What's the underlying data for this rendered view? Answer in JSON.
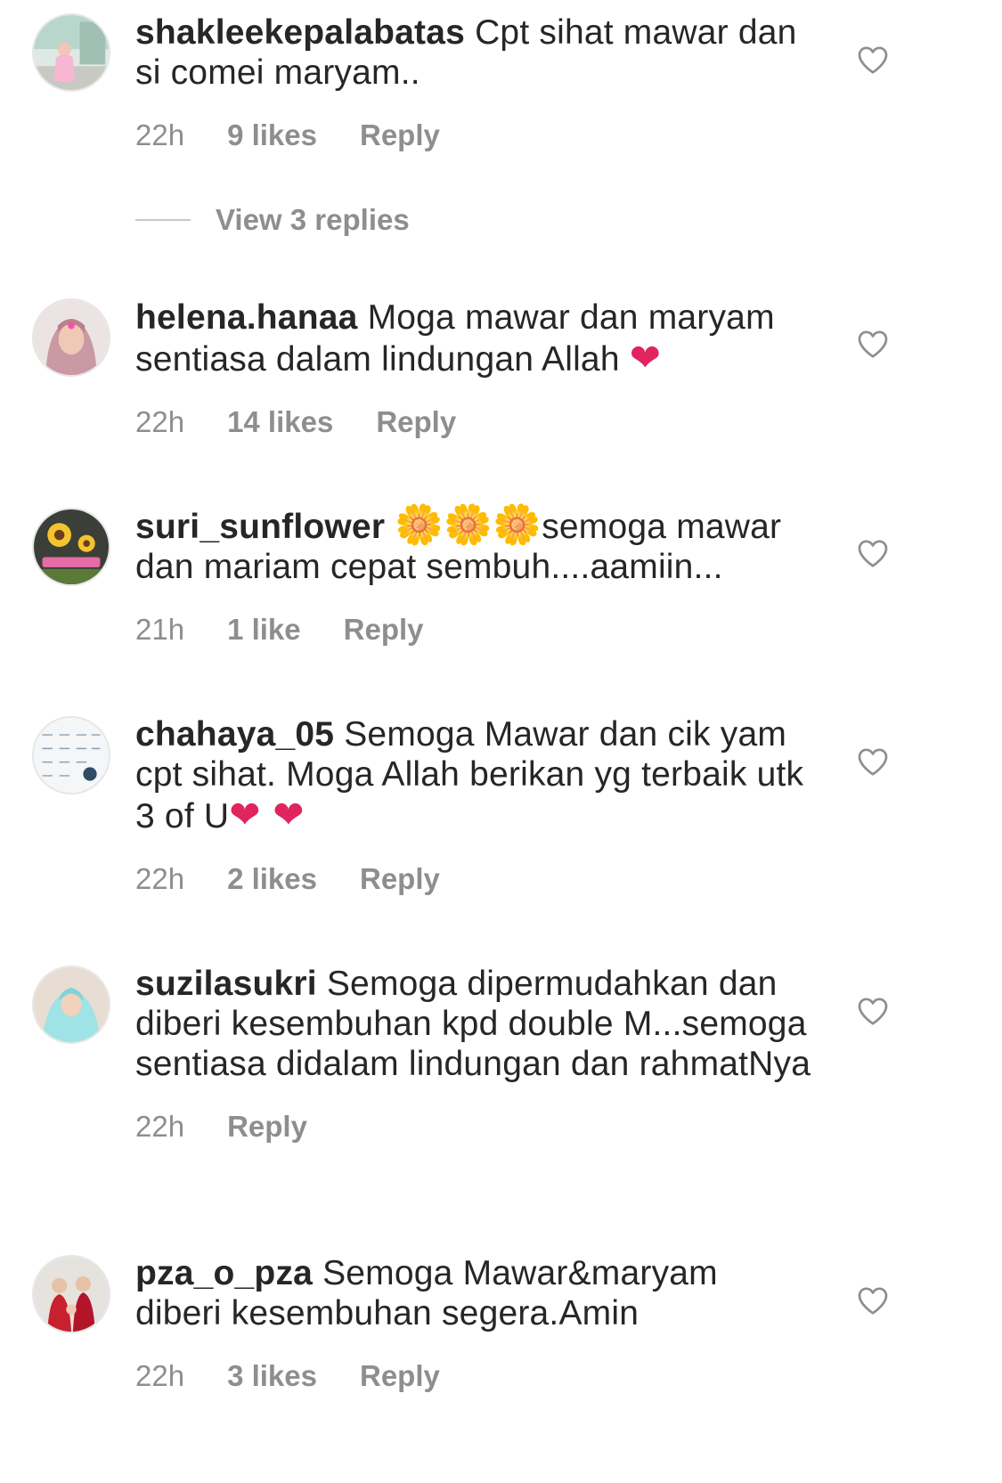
{
  "comments": [
    {
      "username": "shakleekepalabatas",
      "text": "Cpt sihat mawar dan si comei maryam..",
      "time": "22h",
      "likes": "9 likes",
      "reply": "Reply"
    },
    {
      "username": "helena.hanaa",
      "text": "Moga mawar dan maryam sentiasa dalam lindungan Allah",
      "emoji_after": "❤",
      "time": "22h",
      "likes": "14 likes",
      "reply": "Reply"
    },
    {
      "username": "suri_sunflower",
      "emoji_before": "🌼🌼🌼",
      "text": "semoga mawar dan mariam cepat sembuh....aamiin...",
      "time": "21h",
      "likes": "1 like",
      "reply": "Reply"
    },
    {
      "username": "chahaya_05",
      "text": "Semoga Mawar dan cik yam cpt sihat. Moga Allah berikan yg terbaik utk 3 of U",
      "emoji_after": "❤ ❤",
      "time": "22h",
      "likes": "2 likes",
      "reply": "Reply"
    },
    {
      "username": "suzilasukri",
      "text": "Semoga dipermudahkan dan diberi kesembuhan kpd double M...semoga sentiasa didalam lindungan dan rahmatNya",
      "time": "22h",
      "reply": "Reply"
    },
    {
      "username": "pza_o_pza",
      "text": "Semoga Mawar&maryam diberi kesembuhan segera.Amin",
      "time": "22h",
      "likes": "3 likes",
      "reply": "Reply"
    }
  ],
  "view_replies": "View 3 replies",
  "icons": {
    "like": "heart-outline-icon"
  },
  "colors": {
    "text": "#262626",
    "meta": "#8e8e8e",
    "heart_emoji": "#e0245e"
  }
}
